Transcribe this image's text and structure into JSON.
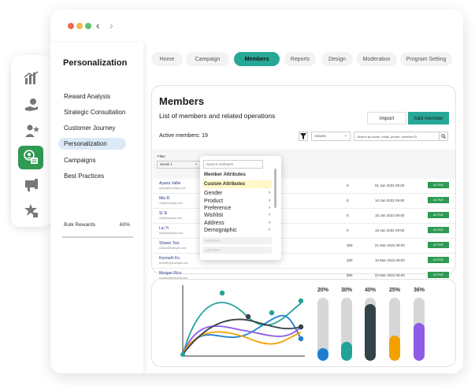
{
  "window": {
    "dots": [
      "#ef6b4d",
      "#f2b84b",
      "#5dc26b"
    ],
    "back_icon": "chevron-left-icon",
    "forward_icon": "chevron-right-icon"
  },
  "rail": {
    "icons": [
      "bar-chart-icon",
      "hand-coin-icon",
      "person-star-icon",
      "member-card-icon",
      "megaphone-icon",
      "badge-star-icon"
    ],
    "active_index": 3,
    "active_color": "#2f9a52"
  },
  "sidebar": {
    "title": "Personalization",
    "items": [
      "Reward Analysis",
      "Strategic Consultation",
      "Customer Journey",
      "Personalization",
      "Campaigns",
      "Best Practices"
    ],
    "active_item": "Personalization",
    "bulk_rewards": {
      "label": "Bulk Rewards",
      "percent": "60%",
      "value": 0.6
    }
  },
  "tabs": {
    "items": [
      "Home",
      "Campaign",
      "Members",
      "Reports",
      "Design",
      "Moderation",
      "Program Setting"
    ],
    "active": "Members",
    "accent": "#27a897"
  },
  "members": {
    "title": "Members",
    "subtitle": "List of members and related operations",
    "import_label": "Import",
    "add_label": "Add member",
    "active_members": "Active members: 19",
    "filter_icon": "funnel-icon",
    "actions_placeholder": "Actions",
    "search_placeholder": "Search by name, email, phone, member ID",
    "search_icon": "search-icon",
    "filter_label": "Filter",
    "filter_value": "Model 1",
    "rows": [
      {
        "name": "Ayana Vallie",
        "email": "ayana@example.com",
        "points": "0",
        "date": "01 Jan 2022 09:00",
        "status": "ACTIVE"
      },
      {
        "name": "Mia R.",
        "email": "mia@example.com",
        "points": "0",
        "date": "10 Jan 2022 09:00",
        "status": "ACTIVE"
      },
      {
        "name": "Si Si",
        "email": "sisi@example.com",
        "points": "0",
        "date": "15 Jan 2022 09:00",
        "status": "ACTIVE"
      },
      {
        "name": "Liu Yi",
        "email": "liuyi@example.com",
        "points": "0",
        "date": "18 Jan 2022 09:00",
        "status": "ACTIVE"
      },
      {
        "name": "Shawn Tsoi",
        "email": "shawn@example.com",
        "points": "300",
        "date": "21 Mar 2022 09:00",
        "status": "ACTIVE"
      },
      {
        "name": "Kenneth Ko",
        "email": "kenneth@example.com",
        "points": "200",
        "date": "10 Mar 2022 09:00",
        "status": "ACTIVE"
      },
      {
        "name": "Morgan Rico",
        "email": "morgan@example.com",
        "points": "500",
        "date": "22 Mar 2022 09:00",
        "status": "ACTIVE"
      }
    ],
    "status_color": "#2f9a52"
  },
  "dropdown": {
    "search_placeholder": "Search Attributes",
    "header_member": "Member Attributes",
    "header_custom": "Custom Attributes",
    "items": [
      "Gender",
      "Product",
      "Preference",
      "Wishlist",
      "Address",
      "Demographic"
    ],
    "disabled": [
      "Add More",
      "Add More"
    ]
  },
  "progress": [
    {
      "label": "20%",
      "value": 0.2,
      "color": "#1e7fd0"
    },
    {
      "label": "30%",
      "value": 0.3,
      "color": "#23a397"
    },
    {
      "label": "40%",
      "value": 0.9,
      "color": "#34434a"
    },
    {
      "label": "25%",
      "value": 0.4,
      "color": "#f4a100"
    },
    {
      "label": "36%",
      "value": 0.6,
      "color": "#8f5ae6"
    }
  ],
  "curves": {
    "colors": [
      "#23a397",
      "#1e7fd0",
      "#8f5ae6",
      "#f4a100",
      "#34434a"
    ],
    "points": [
      "#23a397",
      "#23a397",
      "#23a397",
      "#34434a",
      "#34434a",
      "#1e7fd0"
    ]
  }
}
